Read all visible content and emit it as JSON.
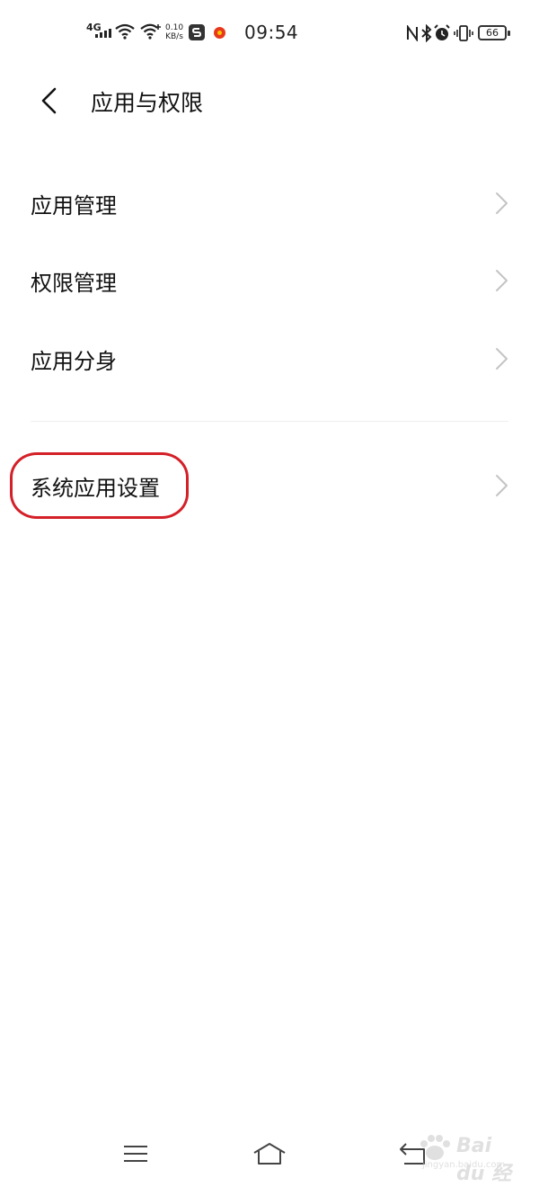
{
  "status_bar": {
    "network_type": "4G",
    "speed_value": "0.10",
    "speed_unit": "KB/s",
    "time": "09:54",
    "battery_level": "66"
  },
  "header": {
    "title": "应用与权限"
  },
  "list": {
    "items": [
      {
        "label": "应用管理"
      },
      {
        "label": "权限管理"
      },
      {
        "label": "应用分身"
      },
      {
        "label": "系统应用设置"
      }
    ]
  },
  "watermark": {
    "brand": "Bai du 经验",
    "url": "jingyan.baidu.com"
  },
  "colors": {
    "highlight": "#d42028",
    "chevron": "#c4c4c4",
    "text": "#111111"
  }
}
